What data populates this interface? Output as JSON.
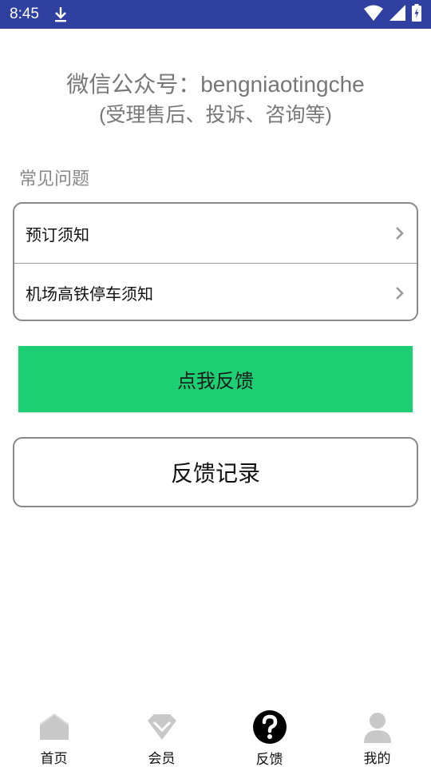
{
  "status_bar": {
    "time": "8:45",
    "icons": [
      "download-icon",
      "wifi-icon",
      "signal-icon",
      "battery-icon"
    ]
  },
  "header": {
    "title": "微信公众号：bengniaotingche",
    "subtitle": "(受理售后、投诉、咨询等)"
  },
  "faq": {
    "section_title": "常见问题",
    "items": [
      {
        "label": "预订须知",
        "icon": "chevron-right-icon"
      },
      {
        "label": "机场高铁停车须知",
        "icon": "chevron-right-icon"
      }
    ]
  },
  "actions": {
    "feedback_label": "点我反馈",
    "record_label": "反馈记录"
  },
  "bottom_nav": {
    "items": [
      {
        "label": "首页",
        "icon": "home-icon",
        "active": false
      },
      {
        "label": "会员",
        "icon": "diamond-icon",
        "active": false
      },
      {
        "label": "反馈",
        "icon": "question-icon",
        "active": true
      },
      {
        "label": "我的",
        "icon": "user-icon",
        "active": false
      }
    ]
  },
  "colors": {
    "status_bar": "#3040a0",
    "accent_green": "#1ccf73",
    "border": "#888888",
    "muted_text": "#777777",
    "inactive_icon": "#c8c8c8",
    "active_icon": "#000000"
  }
}
